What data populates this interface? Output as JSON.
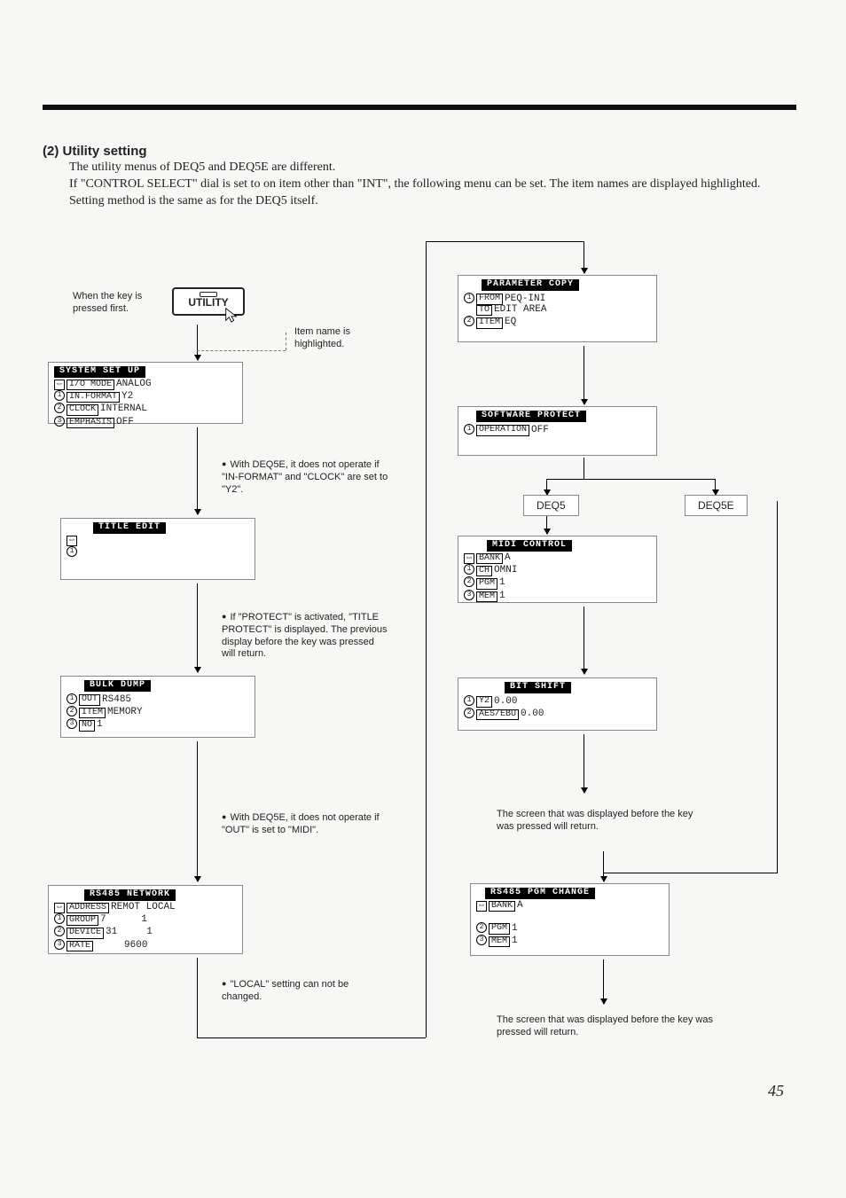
{
  "page_number": "45",
  "section": {
    "number": "(2)",
    "title": "Utility setting"
  },
  "intro": {
    "line1": "The utility menus of DEQ5 and DEQ5E are different.",
    "line2": "If \"CONTROL SELECT\" dial is set to on item other than \"INT\", the following menu can be set. The item names are displayed highlighted.",
    "line3": "Setting method is the same as for the DEQ5 itself."
  },
  "utility_button": "UTILITY",
  "note_key_pressed": "When the key is pressed first.",
  "note_item_highlighted": "Item name is highlighted.",
  "branch_left": "DEQ5",
  "branch_right": "DEQ5E",
  "lcd_system_setup": {
    "title": "SYSTEM SET UP",
    "rows": [
      {
        "idx": "⇔",
        "label": "I/O MODE",
        "val": "ANALOG"
      },
      {
        "idx": "①",
        "label": "IN.FORMAT",
        "val": "Y2"
      },
      {
        "idx": "②",
        "label": "CLOCK",
        "val": "INTERNAL"
      },
      {
        "idx": "③",
        "label": "EMPHASIS",
        "val": "OFF"
      }
    ]
  },
  "note_system_setup": "With DEQ5E, it does not operate if \"IN-FORMAT\" and \"CLOCK\" are set to \"Y2\".",
  "lcd_title_edit": {
    "title": "TITLE EDIT",
    "rows": [
      {
        "idx": "⇔",
        "label": "",
        "val": ""
      },
      {
        "idx": "①",
        "label": "",
        "val": ""
      }
    ]
  },
  "note_title_edit": "If \"PROTECT\" is activated, \"TITLE PROTECT\" is displayed. The previous display before the key was pressed will return.",
  "lcd_bulk_dump": {
    "title": "BULK DUMP",
    "rows": [
      {
        "idx": "①",
        "label": "OUT",
        "val": "RS485"
      },
      {
        "idx": "②",
        "label": "ITEM",
        "val": "MEMORY"
      },
      {
        "idx": "③",
        "label": "NO",
        "val": "1"
      }
    ]
  },
  "note_bulk_dump": "With DEQ5E, it does not operate if \"OUT\" is set to \"MIDI\".",
  "lcd_rs485_network": {
    "title": "RS485 NETWORK",
    "rows": [
      {
        "idx": "⇔",
        "label": "ADDRESS",
        "val": "REMOT LOCAL"
      },
      {
        "idx": "①",
        "label": "GROUP",
        "val": "7      1"
      },
      {
        "idx": "②",
        "label": "DEVICE",
        "val": "31     1"
      },
      {
        "idx": "③",
        "label": "RATE",
        "val": "     9600"
      }
    ]
  },
  "note_rs485_network": "\"LOCAL\" setting can not be changed.",
  "lcd_parameter_copy": {
    "title": "PARAMETER COPY",
    "rows": [
      {
        "idx": "①",
        "label": "FROM",
        "val": "PEQ-INI"
      },
      {
        "idx": "",
        "label": "TO",
        "val": "EDIT AREA"
      },
      {
        "idx": "②",
        "label": "ITEM",
        "val": "EQ"
      }
    ]
  },
  "lcd_software_protect": {
    "title": "SOFTWARE PROTECT",
    "rows": [
      {
        "idx": "①",
        "label": "OPERATION",
        "val": "OFF"
      }
    ]
  },
  "lcd_midi_control": {
    "title": "MIDI CONTROL",
    "rows": [
      {
        "idx": "⇔",
        "label": "BANK",
        "val": "A"
      },
      {
        "idx": "①",
        "label": "CH",
        "val": "OMNI"
      },
      {
        "idx": "②",
        "label": "PGM",
        "val": "1"
      },
      {
        "idx": "③",
        "label": "MEM",
        "val": "1"
      }
    ]
  },
  "lcd_bit_shift": {
    "title": "BIT SHIFT",
    "rows": [
      {
        "idx": "①",
        "label": "Y2",
        "val": "0.00"
      },
      {
        "idx": "②",
        "label": "AES/EBU",
        "val": "0.00"
      }
    ]
  },
  "note_bit_shift_return": "The screen that was displayed before the key was pressed will return.",
  "lcd_rs485_pgm_change": {
    "title": "RS485 PGM CHANGE",
    "rows": [
      {
        "idx": "⇔",
        "label": "BANK",
        "val": "A"
      },
      {
        "idx": "",
        "label": "",
        "val": ""
      },
      {
        "idx": "②",
        "label": "PGM",
        "val": "1"
      },
      {
        "idx": "③",
        "label": "MEM",
        "val": "1"
      }
    ]
  },
  "note_pgm_return": "The screen that was displayed before the key was pressed will return."
}
